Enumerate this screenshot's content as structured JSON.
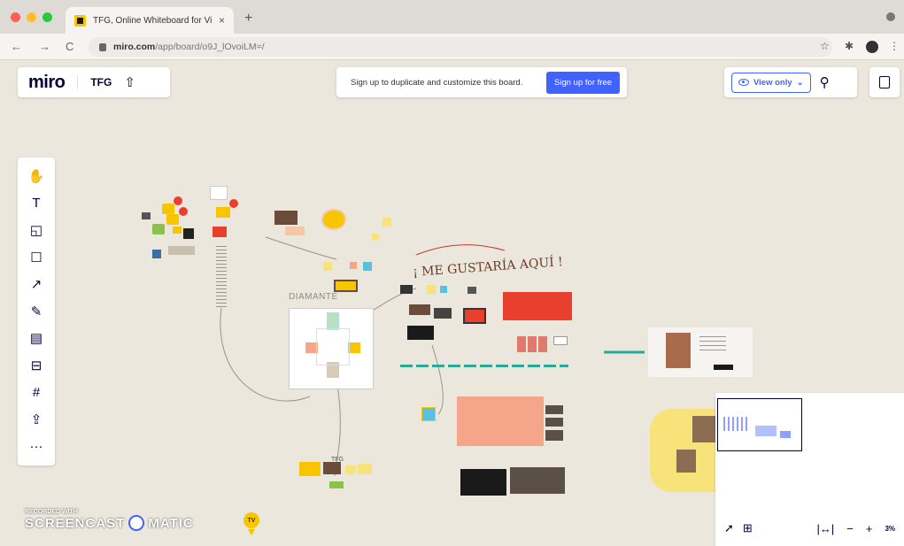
{
  "browser": {
    "tab_title": "TFG, Online Whiteboard for Vi",
    "tab_close": "×",
    "new_tab": "+",
    "url_host": "miro.com",
    "url_path": "/app/board/o9J_lOvoiLM=/",
    "back": "←",
    "forward": "→",
    "reload": "C",
    "star": "☆"
  },
  "header": {
    "logo": "miro",
    "board_name": "TFG",
    "signup_text": "Sign up to duplicate and customize this board.",
    "signup_button": "Sign up for free",
    "view_only": "View only",
    "chevron": "⌄"
  },
  "canvas": {
    "diamante": "DIAMANTE",
    "handwritten": "¡ ME GUSTARÍA AQUÍ !",
    "tfg_label": "TFG"
  },
  "zoom": {
    "fit": "|↔|",
    "minus": "−",
    "plus": "+",
    "level": "3%"
  },
  "watermark": {
    "line1": "RECORDED WITH",
    "line2a": "SCREENCAST",
    "line2b": "MATIC"
  },
  "cursor": {
    "initials": "TV"
  },
  "colors": {
    "accent": "#4262ff",
    "board_bg": "#ebe7dc",
    "sticky_yellow": "#f7e37a",
    "salmon": "#f4a58a",
    "red": "#e8402c",
    "teal": "#2aa89a"
  }
}
